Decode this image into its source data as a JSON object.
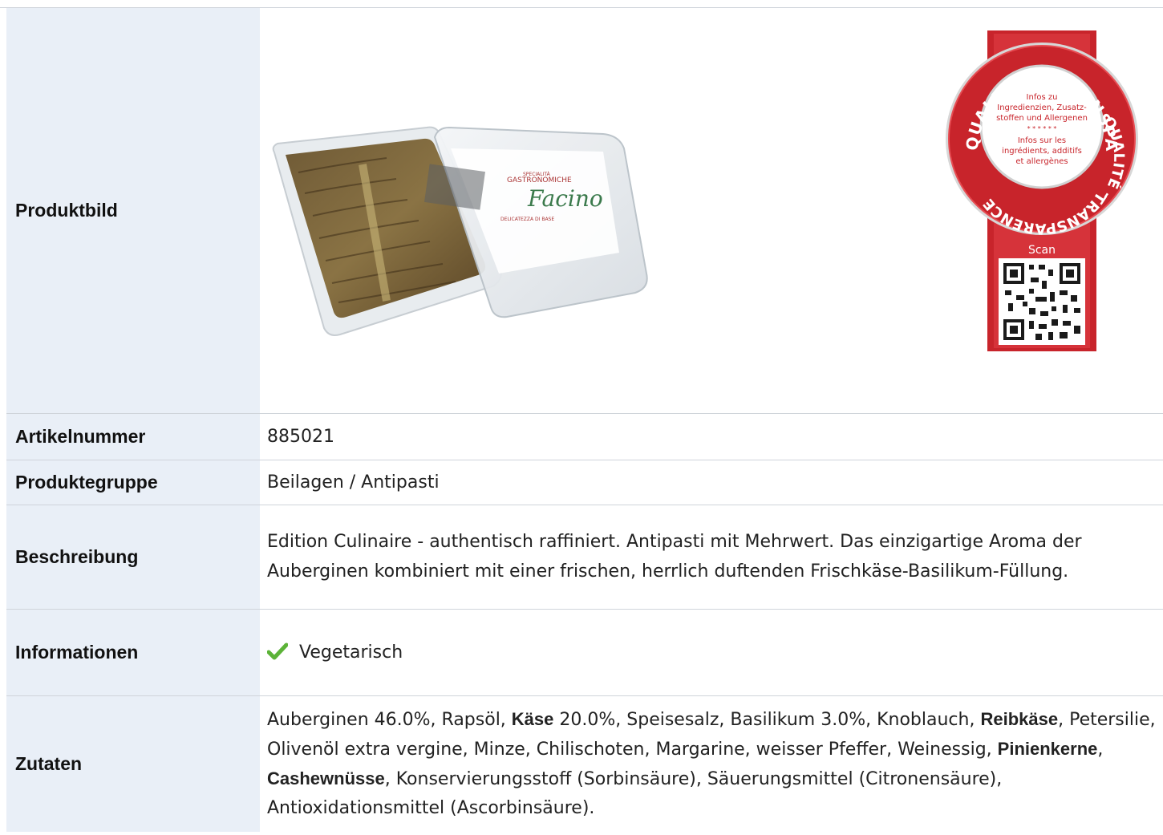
{
  "rows": {
    "image": {
      "label": "Produktbild"
    },
    "article_number": {
      "label": "Artikelnummer",
      "value": "885021"
    },
    "product_group": {
      "label": "Produktegruppe",
      "value": "Beilagen / Antipasti"
    },
    "description": {
      "label": "Beschreibung",
      "value": "Edition Culinaire - authentisch raffiniert. Antipasti mit Mehrwert. Das einzigartige Aroma der Auberginen kombiniert mit einer frischen, herrlich duftenden Frischkäse-Basilikum-Füllung."
    },
    "information": {
      "label": "Informationen",
      "value": "Vegetarisch",
      "icon": "checkmark-icon"
    },
    "ingredients": {
      "label": "Zutaten",
      "parts": [
        "Auberginen 46.0%, Rapsöl, ",
        "Käse",
        " 20.0%, Speisesalz, Basilikum 3.0%, Knoblauch, ",
        "Reibkäse",
        ", Petersilie, Olivenöl extra vergine, Minze, Chilischoten, Margarine, weisser Pfeffer, Weinessig, ",
        "Pinienkerne",
        ", ",
        "Cashewnüsse",
        ", Konservierungsstoff (Sorbinsäure), Säuerungsmittel (Citronensäure), Antioxidationsmittel (Ascorbinsäure)."
      ]
    }
  },
  "product_photo": {
    "pack_label_brand": "Facino",
    "pack_label_top": "GASTRONOMICHE",
    "pack_label_bottom": "SPECIALITÀ",
    "pack_label_sub": "DELICATEZZA DI BASE"
  },
  "seal": {
    "ring_top": "QUALITÄT - TRANSPARENZ -",
    "ring_right": "QUALITÉ - ",
    "ring_bottom": "TRANSPARENCE - ",
    "info_de_1": "Infos zu",
    "info_de_2": "Ingredienzien, Zusatz-",
    "info_de_3": "stoffen und Allergenen",
    "stars": "* * * * * *",
    "info_fr_1": "Infos sur les",
    "info_fr_2": "ingrédients, additifs",
    "info_fr_3": "et allergènes",
    "scan": "Scan"
  },
  "colors": {
    "label_bg": "#e9eff7",
    "seal_red": "#c8242b",
    "check_green": "#5cb338"
  }
}
